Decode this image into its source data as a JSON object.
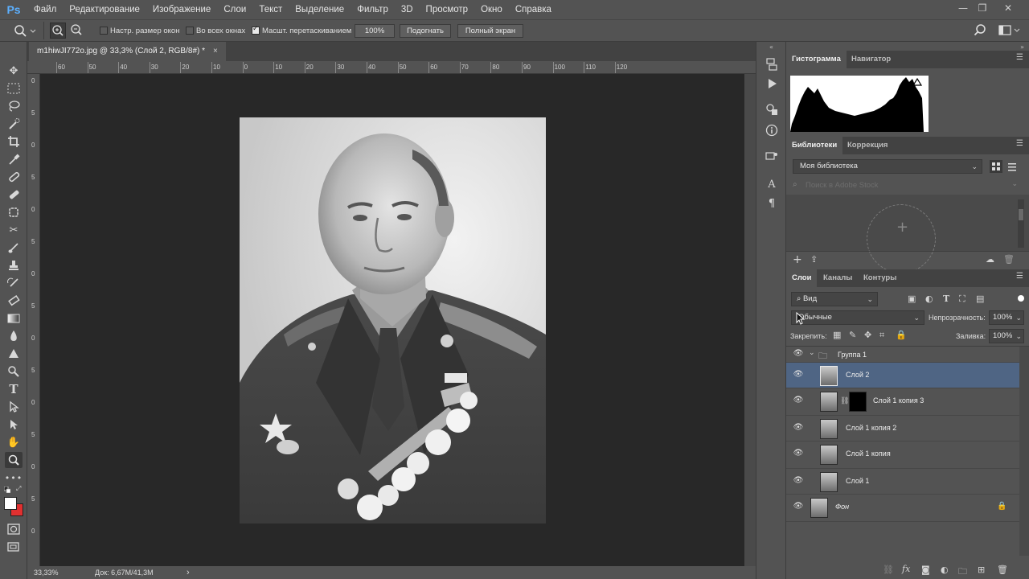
{
  "app": {
    "logo": "Ps",
    "menu": [
      "Файл",
      "Редактирование",
      "Изображение",
      "Слои",
      "Текст",
      "Выделение",
      "Фильтр",
      "3D",
      "Просмотр",
      "Окно",
      "Справка"
    ],
    "window_controls": [
      "—",
      "❐",
      "✕"
    ]
  },
  "options": {
    "resize_windows_label": "Настр. размер окон",
    "resize_windows_checked": false,
    "all_windows_label": "Во всех окнах",
    "all_windows_checked": false,
    "scrubby_zoom_label": "Масшт. перетаскиванием",
    "scrubby_zoom_checked": true,
    "zoom_100_label": "100%",
    "fit_screen_label": "Подогнать",
    "fill_screen_label": "Полный экран"
  },
  "document": {
    "tab_title": "m1hiwJI772o.jpg @ 33,3% (Слой 2, RGB/8#) *",
    "close_glyph": "×",
    "ruler_top": [
      "60",
      "50",
      "40",
      "30",
      "20",
      "10",
      "0",
      "10",
      "20",
      "30",
      "40",
      "50",
      "60",
      "70",
      "80",
      "90",
      "100",
      "110",
      "120"
    ],
    "ruler_left": [
      "0",
      "5",
      "0",
      "5",
      "0",
      "5",
      "0",
      "5",
      "0",
      "5",
      "0",
      "5",
      "0",
      "5",
      "0"
    ]
  },
  "status": {
    "zoom": "33,33%",
    "doc_size": "Док: 6,67M/41,3M",
    "arrow": "›"
  },
  "panels": {
    "histogram_tabs": [
      "Гистограмма",
      "Навигатор"
    ],
    "library_tabs": [
      "Библиотеки",
      "Коррекция"
    ],
    "library_select": "Моя библиотека",
    "library_search_placeholder": "Поиск в Adobe Stock",
    "library_add_glyph": "+",
    "layers_tabs": [
      "Слои",
      "Каналы",
      "Контуры"
    ],
    "layer_filter": "Вид",
    "blend_mode": "Обычные",
    "opacity_label": "Непрозрачность:",
    "opacity_value": "100%",
    "lock_label": "Закрепить:",
    "fill_label": "Заливка:",
    "fill_value": "100%",
    "group_name": "Группа 1",
    "layers": [
      {
        "name": "Слой 2",
        "selected": true,
        "mask": false
      },
      {
        "name": "Слой 1 копия 3",
        "selected": false,
        "mask": true
      },
      {
        "name": "Слой 1 копия 2",
        "selected": false,
        "mask": false
      },
      {
        "name": "Слой 1 копия",
        "selected": false,
        "mask": false
      },
      {
        "name": "Слой 1",
        "selected": false,
        "mask": false
      }
    ],
    "background_layer": "Фон"
  },
  "colors": {
    "foreground": "#ffffff",
    "background": "#e03030",
    "selection": "#4f6584",
    "ps_blue": "#5cb0ff"
  }
}
